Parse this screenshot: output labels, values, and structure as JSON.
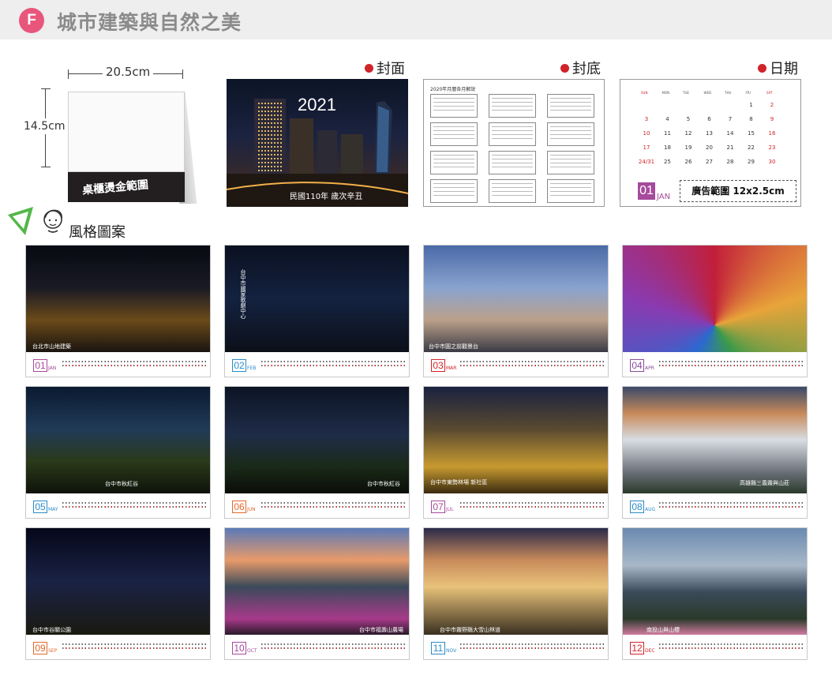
{
  "header": {
    "badge": "F",
    "title": "城市建築與自然之美"
  },
  "product": {
    "width_label": "20.5cm",
    "height_label": "14.5cm",
    "base_text": "桌櫃燙金範圍"
  },
  "sections": {
    "cover": "封面",
    "back_cover": "封底",
    "date": "日期",
    "styles": "風格圖案"
  },
  "cover": {
    "year": "2021",
    "subtitle": "民國110年 歲次辛丑"
  },
  "back_cover": {
    "title": "2020年月曆各月解說"
  },
  "date_sample": {
    "weekdays": [
      "SUN",
      "MON",
      "TUE",
      "WED",
      "THU",
      "FRI",
      "SAT"
    ],
    "days": [
      "",
      "",
      "",
      "",
      "",
      "1",
      "2",
      "3",
      "4",
      "5",
      "6",
      "7",
      "8",
      "9",
      "10",
      "11",
      "12",
      "13",
      "14",
      "15",
      "16",
      "17",
      "18",
      "19",
      "20",
      "21",
      "22",
      "23",
      "24/31",
      "25",
      "26",
      "27",
      "28",
      "29",
      "30"
    ],
    "month_num": "01",
    "month_name": "JAN",
    "ad_text": "廣告範圍 12x2.5cm"
  },
  "months": [
    {
      "num": "01",
      "name": "JAN",
      "caption": "台北市山地建築",
      "color": "#a64a9c"
    },
    {
      "num": "02",
      "name": "FEB",
      "caption": "台中市國家歌劇中心",
      "color": "#2a8bc7"
    },
    {
      "num": "03",
      "name": "MAR",
      "caption": "台中市圓之前觀景台",
      "color": "#d1232a"
    },
    {
      "num": "04",
      "name": "APR",
      "caption": "",
      "color": "#8a4a9c"
    },
    {
      "num": "05",
      "name": "MAY",
      "caption": "台中市秋紅谷",
      "color": "#2a8bc7"
    },
    {
      "num": "06",
      "name": "JUN",
      "caption": "台中市秋紅谷",
      "color": "#e06a2a"
    },
    {
      "num": "07",
      "name": "JUL",
      "caption": "台中市東勢林場 新社區",
      "color": "#a64a9c"
    },
    {
      "num": "08",
      "name": "AUG",
      "caption": "高雄縣三義霧與山莊",
      "color": "#2a8bc7"
    },
    {
      "num": "09",
      "name": "SEP",
      "caption": "台中市谷關公園",
      "color": "#e06a2a"
    },
    {
      "num": "10",
      "name": "OCT",
      "caption": "台中市福壽山農場",
      "color": "#a64a9c"
    },
    {
      "num": "11",
      "name": "NOV",
      "caption": "台中市霧野縣大雪山林道",
      "color": "#2a8bc7"
    },
    {
      "num": "12",
      "name": "DEC",
      "caption": "南投山與山櫻",
      "color": "#d1232a"
    }
  ],
  "colors": {
    "badge": "#e9567c",
    "accent_red": "#d1232a",
    "purple": "#a64a9c"
  }
}
